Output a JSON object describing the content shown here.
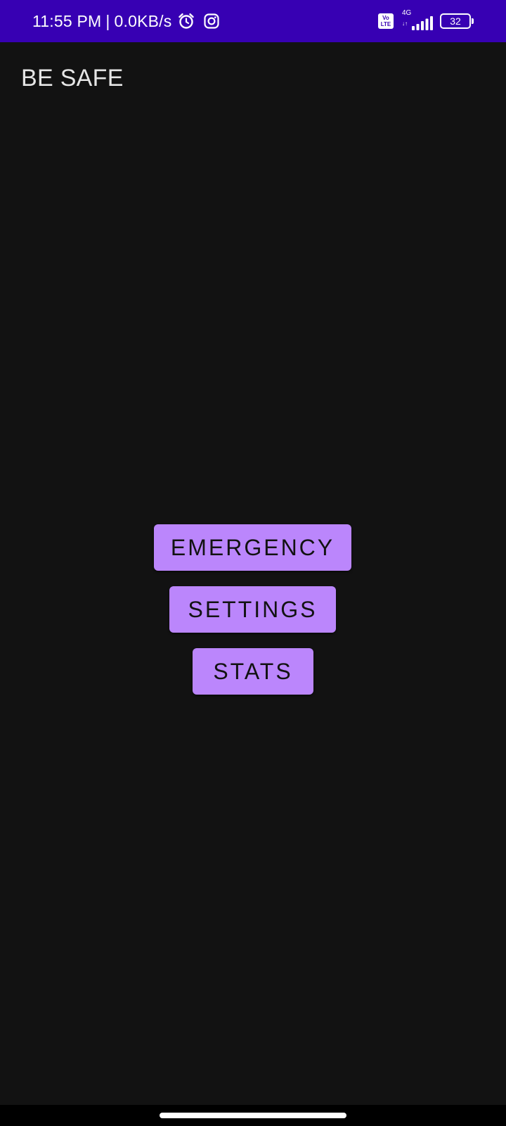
{
  "status_bar": {
    "time": "11:55 PM",
    "separator": "|",
    "speed": "0.0KB/s",
    "volte_top": "Vo",
    "volte_bottom": "LTE",
    "network_type": "4G",
    "network_arrows": "↓↑",
    "battery_level": "32",
    "icons": [
      "alarm-icon",
      "instagram-icon",
      "volte-icon",
      "signal-icon",
      "battery-icon"
    ],
    "background_color": "#3700b3"
  },
  "app_bar": {
    "title": "BE SAFE"
  },
  "main": {
    "buttons": [
      {
        "label": "EMERGENCY"
      },
      {
        "label": "SETTINGS"
      },
      {
        "label": "STATS"
      }
    ],
    "button_color": "#bb86fc",
    "background_color": "#121212"
  }
}
